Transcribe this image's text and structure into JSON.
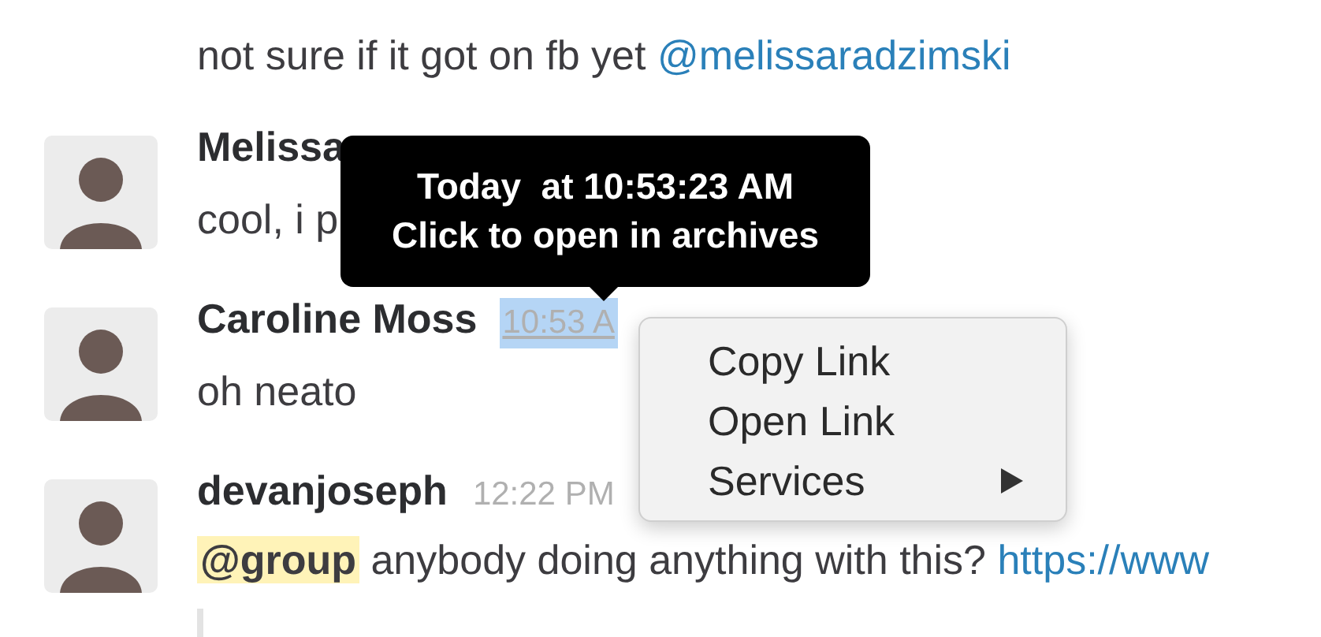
{
  "messages": [
    {
      "kind": "continuation",
      "parts": [
        {
          "kind": "text",
          "text": "not sure if it got on fb yet "
        },
        {
          "kind": "link",
          "text": "@melissaradzimski"
        }
      ]
    },
    {
      "kind": "message",
      "name": "Melissa",
      "parts": [
        {
          "kind": "text",
          "text": "cool, i p"
        }
      ]
    },
    {
      "kind": "message",
      "name": "Caroline Moss",
      "time": "10:53 A",
      "time_selected": true,
      "parts": [
        {
          "kind": "text",
          "text": "oh neato"
        }
      ]
    },
    {
      "kind": "message",
      "name": "devanjoseph",
      "time": "12:22 PM",
      "time_selected": false,
      "parts": [
        {
          "kind": "mention",
          "text": "@group"
        },
        {
          "kind": "text",
          "text": " anybody doing anything with this? "
        },
        {
          "kind": "link",
          "text": "https://www"
        }
      ],
      "quote": true
    }
  ],
  "tooltip": {
    "lines": [
      "Today  at 10:53:23 AM",
      "Click to open in archives"
    ]
  },
  "context_menu": {
    "items": [
      {
        "label": "Copy Link",
        "submenu": false
      },
      {
        "label": "Open Link",
        "submenu": false
      },
      {
        "label": "Services",
        "submenu": true
      }
    ]
  }
}
